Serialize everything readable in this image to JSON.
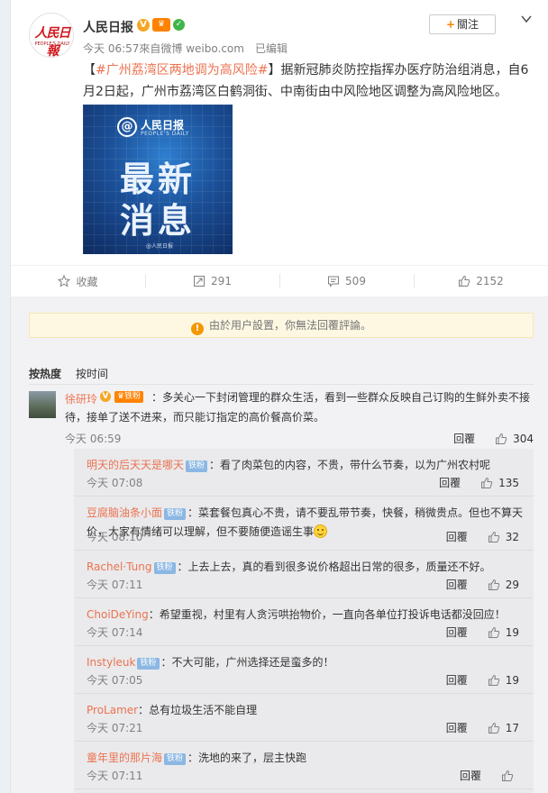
{
  "post": {
    "author": "人民日报",
    "avatar_text": "人民日報",
    "avatar_subtext": "PEOPLE'S DAILY",
    "follow_label": "關注",
    "meta": {
      "time": "今天 06:57",
      "source": "來自微博 weibo.com",
      "edited": "已编辑"
    },
    "topic": "#广州荔湾区两地调为高风险#",
    "text_after_topic": "据新冠肺炎防控指挥办医疗防治组消息，自6月2日起，广州市荔湾区白鹤洞街、中南街由中风险地区调整为高风险地区。",
    "image": {
      "logo_name": "人民日报",
      "logo_en": "PEOPLE'S DAILY",
      "line1": "最新",
      "line2": "消息",
      "watermark": "@人民日报"
    }
  },
  "actions": {
    "favorite": "收藏",
    "repost_count": "291",
    "comment_count": "509",
    "like_count": "2152"
  },
  "notice": "由於用户設置，你無法回覆評論。",
  "sort": {
    "by_hot": "按热度",
    "by_time": "按时间"
  },
  "top_comment": {
    "user": "徐研玲",
    "fan_badge": "铁粉",
    "text": "：多关心一下封闭管理的群众生活，看到一些群众反映自己订购的生鲜外卖不接待，接单了送不进来，而只能订指定的高价餐高价菜。",
    "time": "今天 06:59",
    "reply": "回覆",
    "likes": "304"
  },
  "sub_comments": [
    {
      "user": "明天的后天天是哪天",
      "fan": "铁粉",
      "text": "：看了肉菜包的内容，不贵，带什么节奏，以为广州农村呢",
      "time": "今天 07:08",
      "reply": "回覆",
      "likes": "135"
    },
    {
      "user": "豆腐脑油条小面",
      "fan": "铁粉",
      "text": "：菜套餐包真心不贵，请不要乱带节奏，快餐，稍微贵点。但也不算天价，大家有情绪可以理解，但不要随便造谣生事",
      "time": "今天 08:10",
      "reply": "回覆",
      "likes": "32"
    },
    {
      "user": "Rachel·Tung",
      "fan": "铁粉",
      "text": "：上去上去，真的看到很多说价格超出日常的很多，质量还不好。",
      "time": "今天 07:11",
      "reply": "回覆",
      "likes": "29"
    },
    {
      "user": "ChoiDeYing",
      "fan": "",
      "text": "：希望重视，村里有人贪污哄抬物价，一直向各单位打投诉电话都没回应！",
      "time": "今天 07:14",
      "reply": "回覆",
      "likes": "19"
    },
    {
      "user": "Instyleuk",
      "fan": "铁粉",
      "text": "：不大可能，广州选择还是蛮多的！",
      "time": "今天 07:05",
      "reply": "回覆",
      "likes": "19"
    },
    {
      "user": "ProLamer",
      "fan": "",
      "text": "：总有垃圾生活不能自理",
      "time": "今天 07:21",
      "reply": "回覆",
      "likes": "17"
    },
    {
      "user": "童年里的那片海",
      "fan": "铁粉",
      "text": "：洗地的来了，层主快跑",
      "time": "今天 07:11",
      "reply": "回覆",
      "likes": ""
    }
  ],
  "colors": {
    "accent": "#eb7350",
    "brand_orange": "#ff8200",
    "notice_bg": "#fef8e2"
  }
}
